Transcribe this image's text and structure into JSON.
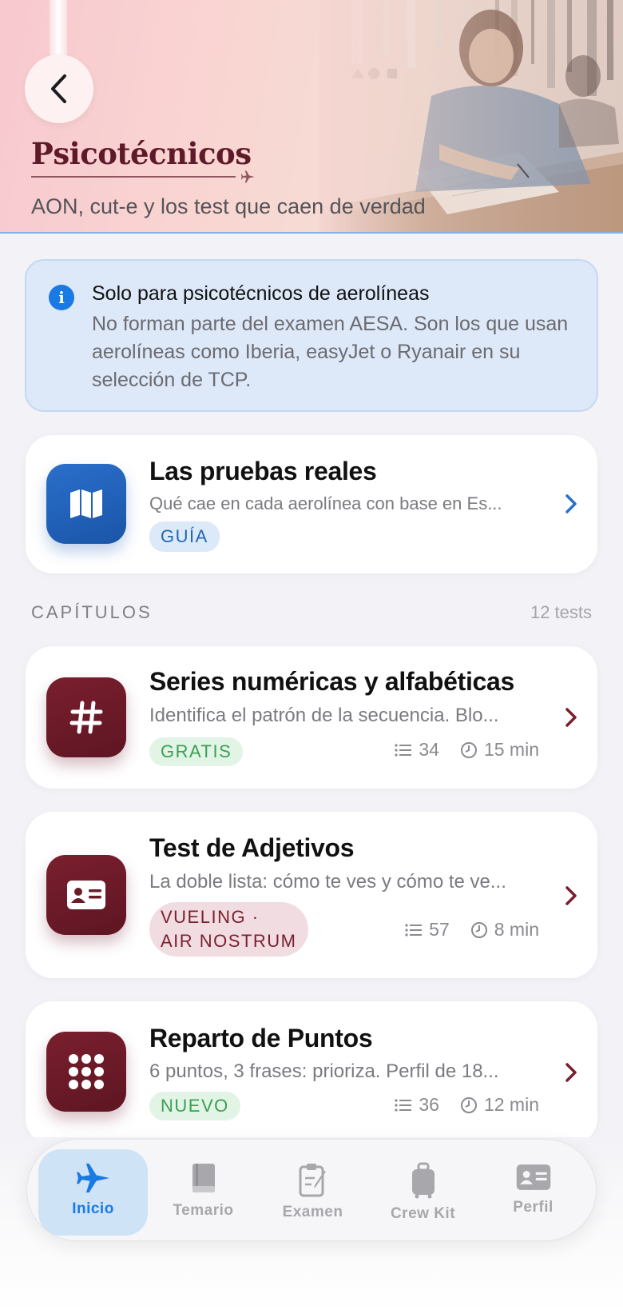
{
  "header": {
    "title": "Psicotécnicos",
    "subtitle": "AON, cut-e y los test que caen de verdad"
  },
  "info": {
    "icon": "info-icon",
    "title": "Solo para psicotécnicos de aerolíneas",
    "body": "No forman parte del examen AESA. Son los que usan aerolíneas como Iberia, easyJet o Ryanair en su selección de TCP."
  },
  "guide_card": {
    "icon": "map-icon",
    "title": "Las pruebas reales",
    "description": "Qué cae en cada aerolínea con base en Es...",
    "badge": "GUÍA"
  },
  "chapters": {
    "label": "CAPÍTULOS",
    "count": "12 tests",
    "items": [
      {
        "icon": "hash-icon",
        "title": "Series numéricas y alfabéticas",
        "description": "Identifica el patrón de la secuencia. Blo...",
        "badge": "GRATIS",
        "questions": "34",
        "duration": "15 min"
      },
      {
        "icon": "id-card-icon",
        "title": "Test de Adjetivos",
        "description": "La doble lista: cómo te ves y cómo te ve...",
        "badge_line1": "VUELING ·",
        "badge_line2": "AIR NOSTRUM",
        "questions": "57",
        "duration": "8 min"
      },
      {
        "icon": "grid-dots-icon",
        "title": "Reparto de Puntos",
        "description": "6 puntos, 3 frases: prioriza. Perfil de 18...",
        "badge": "NUEVO",
        "questions": "36",
        "duration": "12 min"
      }
    ]
  },
  "tabbar": {
    "items": [
      {
        "label": "Inicio",
        "icon": "airplane-icon",
        "active": true
      },
      {
        "label": "Temario",
        "icon": "book-icon",
        "active": false
      },
      {
        "label": "Examen",
        "icon": "clipboard-pen-icon",
        "active": false
      },
      {
        "label": "Crew Kit",
        "icon": "suitcase-icon",
        "active": false
      },
      {
        "label": "Perfil",
        "icon": "id-card-icon",
        "active": false
      }
    ]
  },
  "colors": {
    "accent_blue": "#1a7ae3",
    "wine": "#6d1b29",
    "green": "#3aa052"
  }
}
